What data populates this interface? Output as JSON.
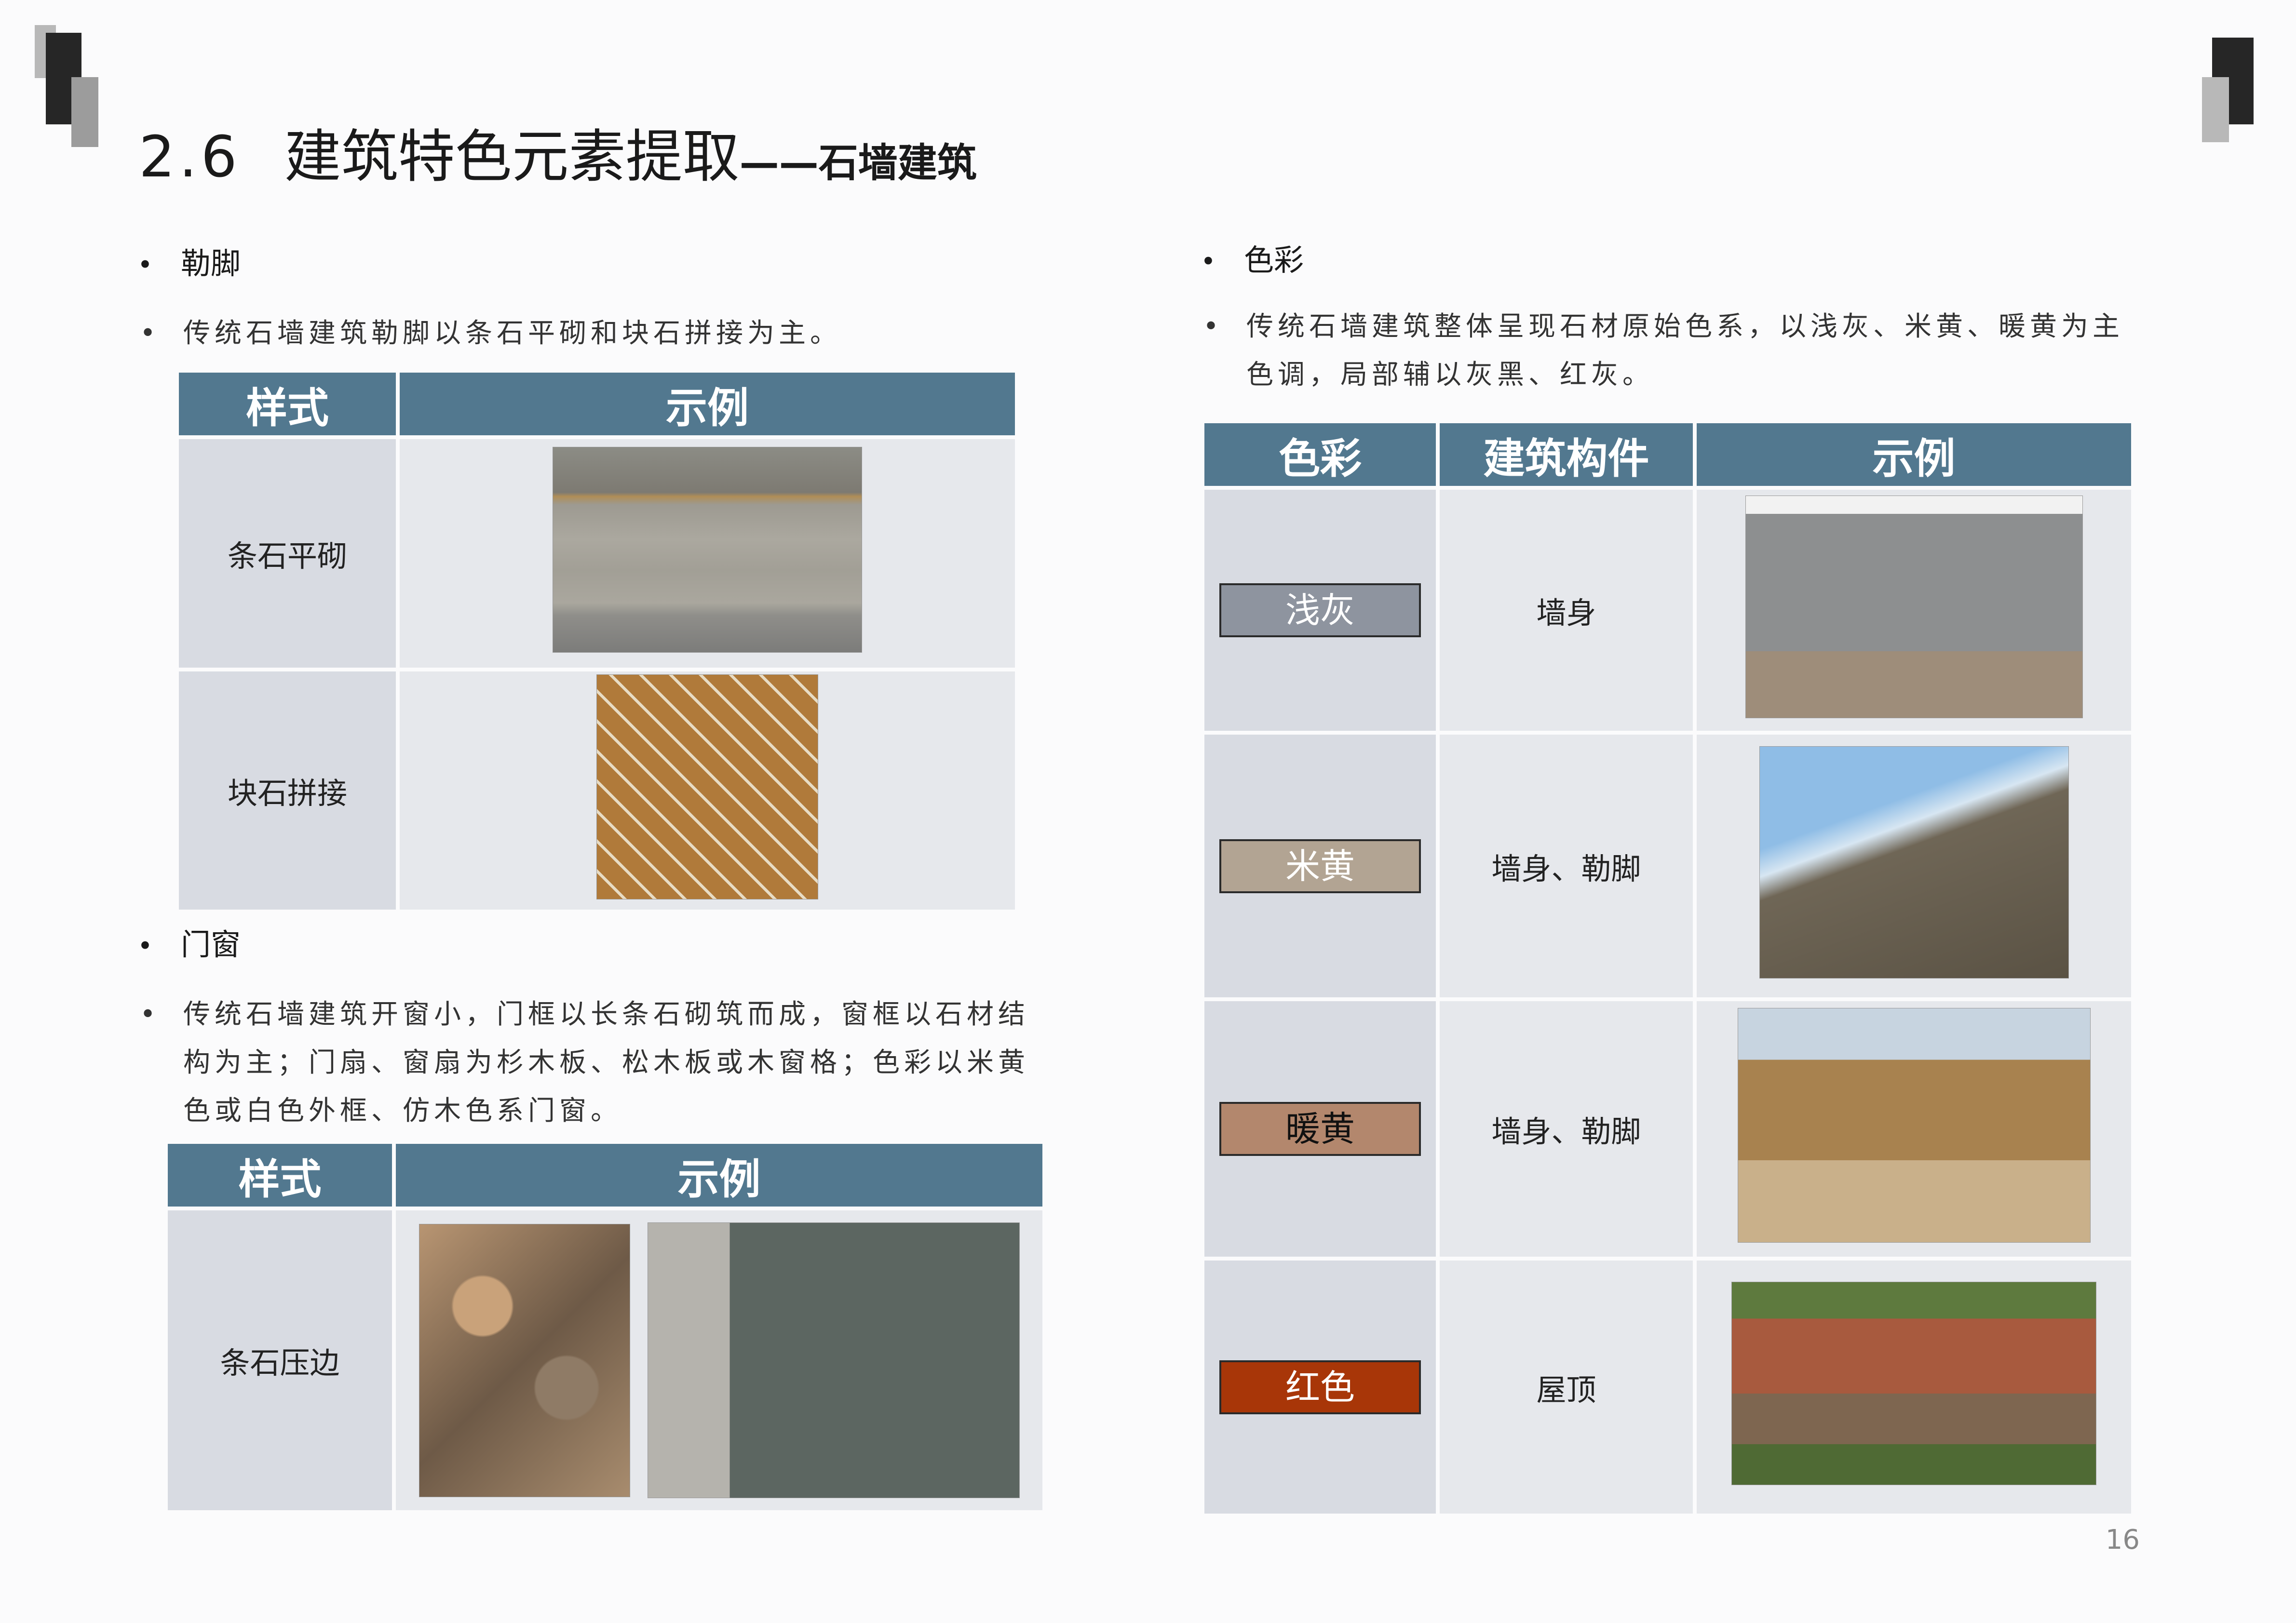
{
  "page": {
    "section_number": "2.6",
    "section_title": "建筑特色元素提取",
    "section_subtitle": "——石墙建筑",
    "page_number": "16"
  },
  "left": {
    "plinth": {
      "heading": "勒脚",
      "text": "传统石墙建筑勒脚以条石平砌和块石拼接为主。",
      "table": {
        "headers": [
          "样式",
          "示例"
        ],
        "rows": [
          {
            "style": "条石平砌",
            "photo": "dressed-stone-course-photo"
          },
          {
            "style": "块石拼接",
            "photo": "rubble-stone-joint-photo"
          }
        ]
      }
    },
    "doors": {
      "heading": "门窗",
      "text": "传统石墙建筑开窗小，门框以长条石砌筑而成，窗框以石材结构为主；门扇、窗扇为杉木板、松木板或木窗格；色彩以米黄色或白色外框、仿木色系门窗。",
      "table": {
        "headers": [
          "样式",
          "示例"
        ],
        "rows": [
          {
            "style": "条石压边",
            "photos": [
              "stone-window-photo-1",
              "stone-window-photo-2"
            ]
          }
        ]
      }
    }
  },
  "right": {
    "color": {
      "heading": "色彩",
      "text": "传统石墙建筑整体呈现石材原始色系，以浅灰、米黄、暖黄为主色调，局部辅以灰黑、红灰。",
      "table": {
        "headers": [
          "色彩",
          "建筑构件",
          "示例"
        ],
        "rows": [
          {
            "color_name": "浅灰",
            "swatch": "#8e949f",
            "component": "墙身",
            "photo": "grey-stone-mansion-photo"
          },
          {
            "color_name": "米黄",
            "swatch": "#b2a493",
            "component": "墙身、勒脚",
            "photo": "beige-stone-wall-photo"
          },
          {
            "color_name": "暖黄",
            "swatch": "#b3876d",
            "component": "墙身、勒脚",
            "photo": "warm-yellow-village-photo"
          },
          {
            "color_name": "红色",
            "swatch": "#a83608",
            "component": "屋顶",
            "photo": "red-roof-village-photo"
          }
        ]
      }
    }
  },
  "colors": {
    "header": "#52788f",
    "cell_label": "#d8dbe2",
    "cell_example": "#e6e8ec"
  }
}
